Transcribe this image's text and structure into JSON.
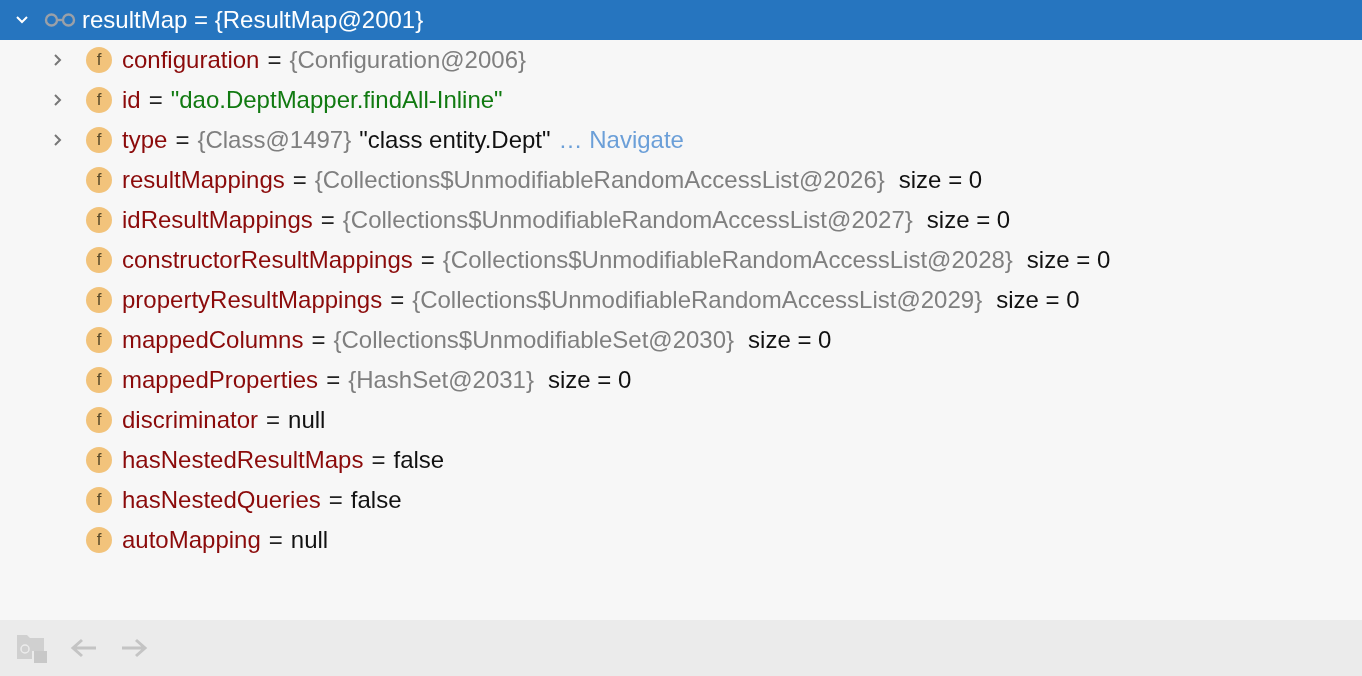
{
  "root": {
    "expanded": true,
    "selected": true,
    "text": "resultMap = {ResultMap@2001}"
  },
  "fields": [
    {
      "expanded": false,
      "icon": "f",
      "segments": [
        {
          "kind": "name",
          "text": "configuration"
        },
        {
          "kind": "operator",
          "text": "="
        },
        {
          "kind": "ref",
          "text": "{Configuration@2006}"
        }
      ]
    },
    {
      "expanded": false,
      "icon": "f",
      "segments": [
        {
          "kind": "name",
          "text": "id"
        },
        {
          "kind": "operator",
          "text": "="
        },
        {
          "kind": "string",
          "text": "\"dao.DeptMapper.findAll-Inline\""
        }
      ]
    },
    {
      "expanded": false,
      "icon": "f",
      "segments": [
        {
          "kind": "name",
          "text": "type"
        },
        {
          "kind": "operator",
          "text": "="
        },
        {
          "kind": "ref",
          "text": "{Class@1497}"
        },
        {
          "kind": "plain",
          "text": "\"class entity.Dept\""
        },
        {
          "kind": "link",
          "text": "… Navigate"
        }
      ]
    },
    {
      "icon": "f",
      "segments": [
        {
          "kind": "name",
          "text": "resultMappings"
        },
        {
          "kind": "operator",
          "text": "="
        },
        {
          "kind": "ref",
          "text": "{Collections$UnmodifiableRandomAccessList@2026}"
        },
        {
          "kind": "size",
          "text": "size = 0"
        }
      ]
    },
    {
      "icon": "f",
      "segments": [
        {
          "kind": "name",
          "text": "idResultMappings"
        },
        {
          "kind": "operator",
          "text": "="
        },
        {
          "kind": "ref",
          "text": "{Collections$UnmodifiableRandomAccessList@2027}"
        },
        {
          "kind": "size",
          "text": "size = 0"
        }
      ]
    },
    {
      "icon": "f",
      "segments": [
        {
          "kind": "name",
          "text": "constructorResultMappings"
        },
        {
          "kind": "operator",
          "text": "="
        },
        {
          "kind": "ref",
          "text": "{Collections$UnmodifiableRandomAccessList@2028}"
        },
        {
          "kind": "size",
          "text": "size = 0"
        }
      ]
    },
    {
      "icon": "f",
      "segments": [
        {
          "kind": "name",
          "text": "propertyResultMappings"
        },
        {
          "kind": "operator",
          "text": "="
        },
        {
          "kind": "ref",
          "text": "{Collections$UnmodifiableRandomAccessList@2029}"
        },
        {
          "kind": "size",
          "text": "size = 0"
        }
      ]
    },
    {
      "icon": "f",
      "segments": [
        {
          "kind": "name",
          "text": "mappedColumns"
        },
        {
          "kind": "operator",
          "text": "="
        },
        {
          "kind": "ref",
          "text": "{Collections$UnmodifiableSet@2030}"
        },
        {
          "kind": "size",
          "text": "size = 0"
        }
      ]
    },
    {
      "icon": "f",
      "segments": [
        {
          "kind": "name",
          "text": "mappedProperties"
        },
        {
          "kind": "operator",
          "text": "="
        },
        {
          "kind": "ref",
          "text": "{HashSet@2031}"
        },
        {
          "kind": "size",
          "text": "size = 0"
        }
      ]
    },
    {
      "icon": "f",
      "segments": [
        {
          "kind": "name",
          "text": "discriminator"
        },
        {
          "kind": "operator",
          "text": "="
        },
        {
          "kind": "plain",
          "text": "null"
        }
      ]
    },
    {
      "icon": "f",
      "segments": [
        {
          "kind": "name",
          "text": "hasNestedResultMaps"
        },
        {
          "kind": "operator",
          "text": "="
        },
        {
          "kind": "plain",
          "text": "false"
        }
      ]
    },
    {
      "icon": "f",
      "segments": [
        {
          "kind": "name",
          "text": "hasNestedQueries"
        },
        {
          "kind": "operator",
          "text": "="
        },
        {
          "kind": "plain",
          "text": "false"
        }
      ]
    },
    {
      "icon": "f",
      "segments": [
        {
          "kind": "name",
          "text": "autoMapping"
        },
        {
          "kind": "operator",
          "text": "="
        },
        {
          "kind": "plain",
          "text": "null"
        }
      ]
    }
  ]
}
